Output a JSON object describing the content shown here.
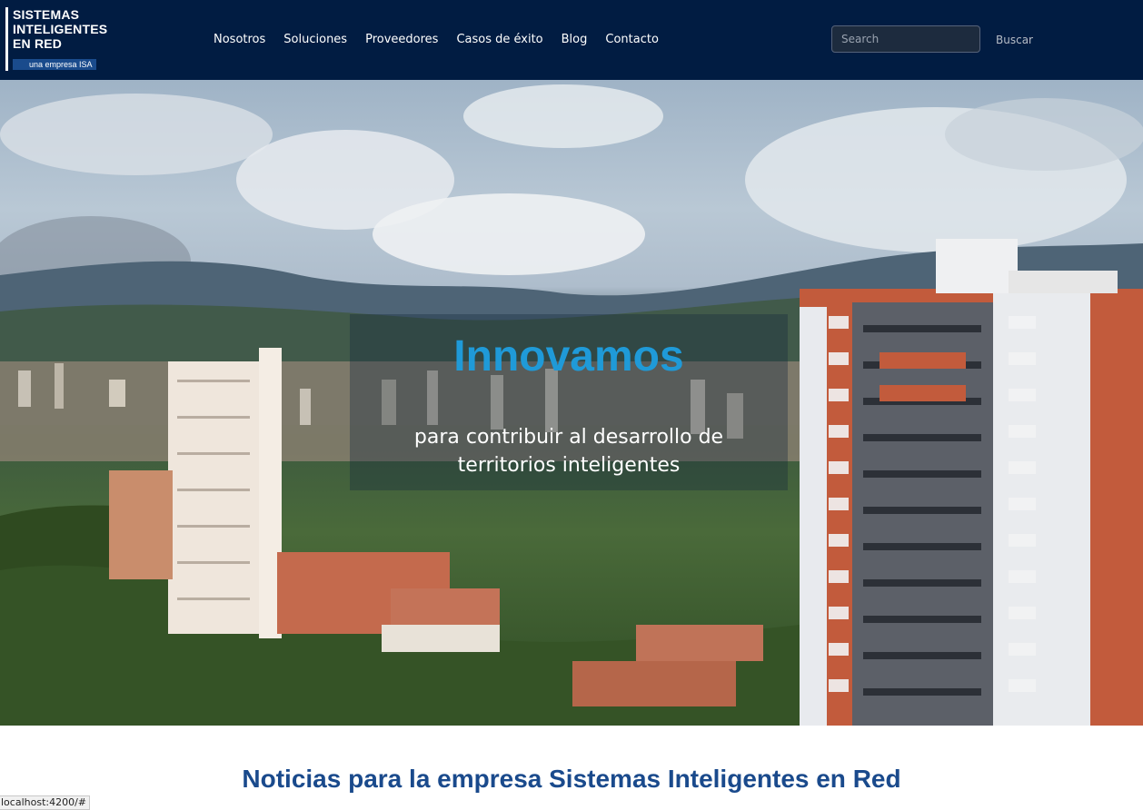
{
  "navbar": {
    "logo": {
      "lines": [
        "SISTEMAS",
        "INTELIGENTES",
        "EN RED"
      ],
      "tagline": "una empresa ISA"
    },
    "menu": [
      {
        "label": "Nosotros"
      },
      {
        "label": "Soluciones"
      },
      {
        "label": "Proveedores"
      },
      {
        "label": "Casos de éxito"
      },
      {
        "label": "Blog"
      },
      {
        "label": "Contacto"
      }
    ],
    "search": {
      "placeholder": "Search",
      "value": "",
      "button_label": "Buscar"
    }
  },
  "hero": {
    "title": "Innovamos",
    "subtitle": "para contribuir al desarrollo de territorios inteligentes"
  },
  "news": {
    "title": "Noticias para la empresa Sistemas Inteligentes en Red"
  },
  "status_bar": {
    "url": "localhost:4200/#"
  },
  "colors": {
    "navbar_bg": "#011c42",
    "hero_title": "#1f9ad8",
    "section_title": "#1a4a8c"
  }
}
